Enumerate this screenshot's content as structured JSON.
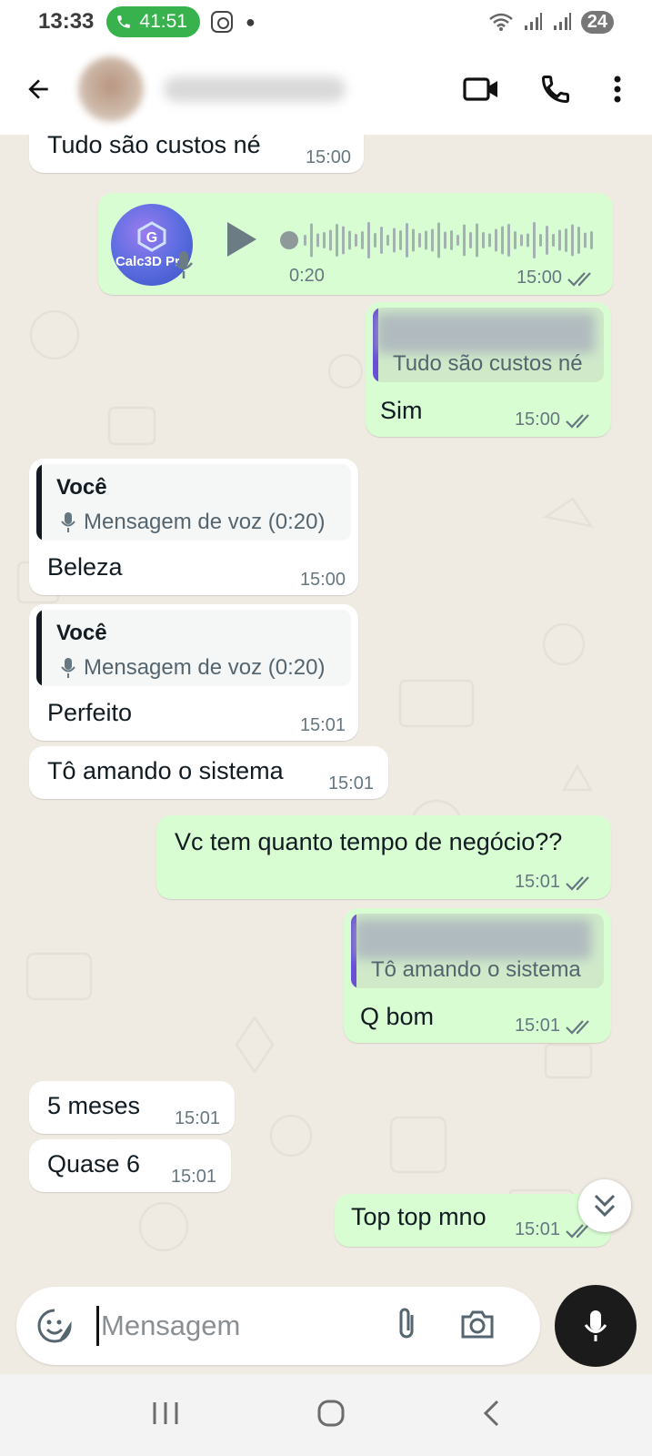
{
  "status_bar": {
    "time": "13:33",
    "call_duration": "41:51",
    "battery": "24",
    "accent": "#37b24d"
  },
  "header": {
    "back_icon": "arrow-left-icon",
    "video_icon": "video-call-icon",
    "call_icon": "phone-icon",
    "menu_icon": "more-vertical-icon"
  },
  "messages": [
    {
      "dir": "in",
      "text": "Tudo são custos né",
      "time": "15:00"
    },
    {
      "dir": "out",
      "type": "voice",
      "sender_label": "Calc3D Pro",
      "duration": "0:20",
      "time": "15:00",
      "read": true
    },
    {
      "dir": "out",
      "quote_text": "Tudo são custos né",
      "text": "Sim",
      "time": "15:00",
      "read": true
    },
    {
      "dir": "in",
      "quote_author": "Você",
      "quote_text": "Mensagem de voz (0:20)",
      "text": "Beleza",
      "time": "15:00"
    },
    {
      "dir": "in",
      "quote_author": "Você",
      "quote_text": "Mensagem de voz (0:20)",
      "text": "Perfeito",
      "time": "15:01"
    },
    {
      "dir": "in",
      "text": "Tô amando o sistema",
      "time": "15:01"
    },
    {
      "dir": "out",
      "text": "Vc tem quanto tempo de negócio??",
      "time": "15:01",
      "read": true
    },
    {
      "dir": "out",
      "quote_text": "Tô amando o sistema",
      "text": "Q bom",
      "time": "15:01",
      "read": true
    },
    {
      "dir": "in",
      "text": "5 meses",
      "time": "15:01"
    },
    {
      "dir": "in",
      "text": "Quase 6",
      "time": "15:01"
    },
    {
      "dir": "out",
      "text": "Top top mno",
      "time": "15:01",
      "read": true
    }
  ],
  "composer": {
    "placeholder": "Mensagem",
    "emoji_icon": "sticker-icon",
    "attach_icon": "paperclip-icon",
    "camera_icon": "camera-icon",
    "mic_icon": "mic-icon"
  },
  "colors": {
    "incoming_bubble": "#ffffff",
    "outgoing_bubble": "#d9fdd3",
    "read_ticks": "#667781",
    "quote_bar_in": "#111b21",
    "quote_bar_out": "#6a4fd6"
  }
}
